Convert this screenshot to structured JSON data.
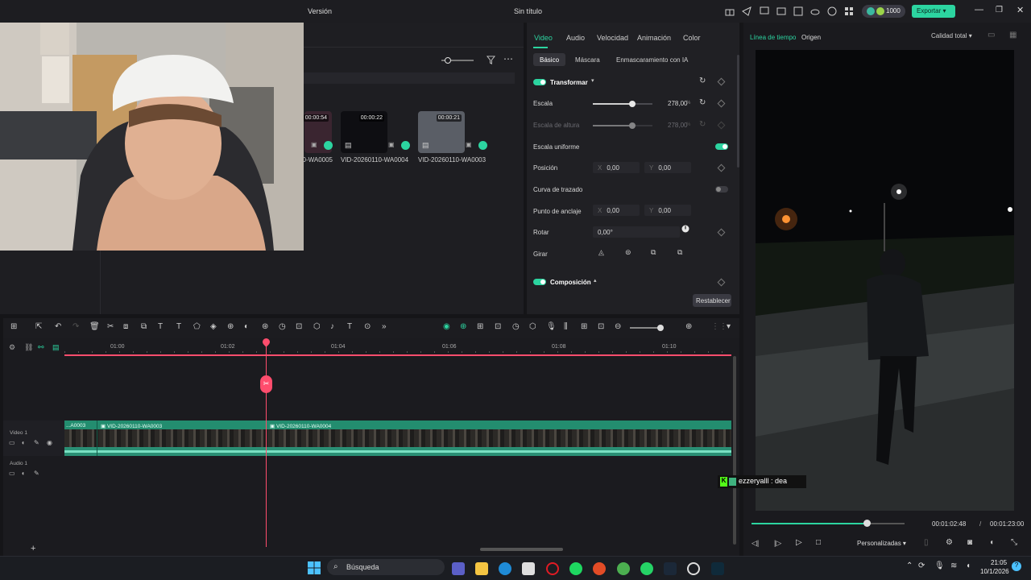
{
  "titlebar": {
    "version": "Versión",
    "title": "Sin título",
    "credits": "1000",
    "export": "Exportar"
  },
  "media": {
    "clips": [
      {
        "dur": "00:00:54",
        "label": "VID-20260110-WA0005"
      },
      {
        "dur": "00:00:22",
        "label": "VID-20260110-WA0004"
      },
      {
        "dur": "00:00:21",
        "label": "VID-20260110-WA0003"
      }
    ]
  },
  "props": {
    "tabs": [
      "Video",
      "Audio",
      "Velocidad",
      "Animación",
      "Color"
    ],
    "subtabs": [
      "Básico",
      "Máscara",
      "Enmascaramiento con IA"
    ],
    "transformar": "Transformar",
    "escala": {
      "label": "Escala",
      "value": "278,00",
      "unit": "%",
      "level": 0.66
    },
    "escala_altura": {
      "label": "Escala de altura",
      "value": "278,00",
      "unit": "%"
    },
    "uniforme": "Escala uniforme",
    "posicion": {
      "label": "Posición",
      "x_label": "X",
      "x": "0,00",
      "y_label": "Y",
      "y": "0,00"
    },
    "curva": "Curva de trazado",
    "anclaje": {
      "label": "Punto de anclaje",
      "x_label": "X",
      "x": "0,00",
      "y_label": "Y",
      "y": "0,00"
    },
    "rotar": {
      "label": "Rotar",
      "value": "0,00°"
    },
    "girar": "Girar",
    "composicion": "Composición",
    "reset": "Restablecer"
  },
  "player": {
    "tabs": [
      "Línea de tiempo",
      "Origen"
    ],
    "quality": "Calidad total",
    "current": "00:01:02:48",
    "sep": "/",
    "total": "00:01:23:00",
    "progress": 0.75,
    "mode": "Personalizadas"
  },
  "timeline": {
    "ticks": [
      "01:00",
      "01:02",
      "01:04",
      "01:06",
      "01:08",
      "01:10"
    ],
    "tracks": {
      "video": "Video 1",
      "audio": "Audio 1"
    },
    "clips": [
      "...A0003",
      "VID-20260110-WA0003",
      "VID-20260110-WA0004"
    ]
  },
  "chat": {
    "text": "ezzeryalll : dea"
  },
  "taskbar": {
    "search": "Búsqueda",
    "time": "21:05",
    "date": "10/1/2026"
  },
  "colors": {
    "accent": "#2cd4a0",
    "playhead": "#ff4d6d",
    "clip": "#238d6f"
  }
}
